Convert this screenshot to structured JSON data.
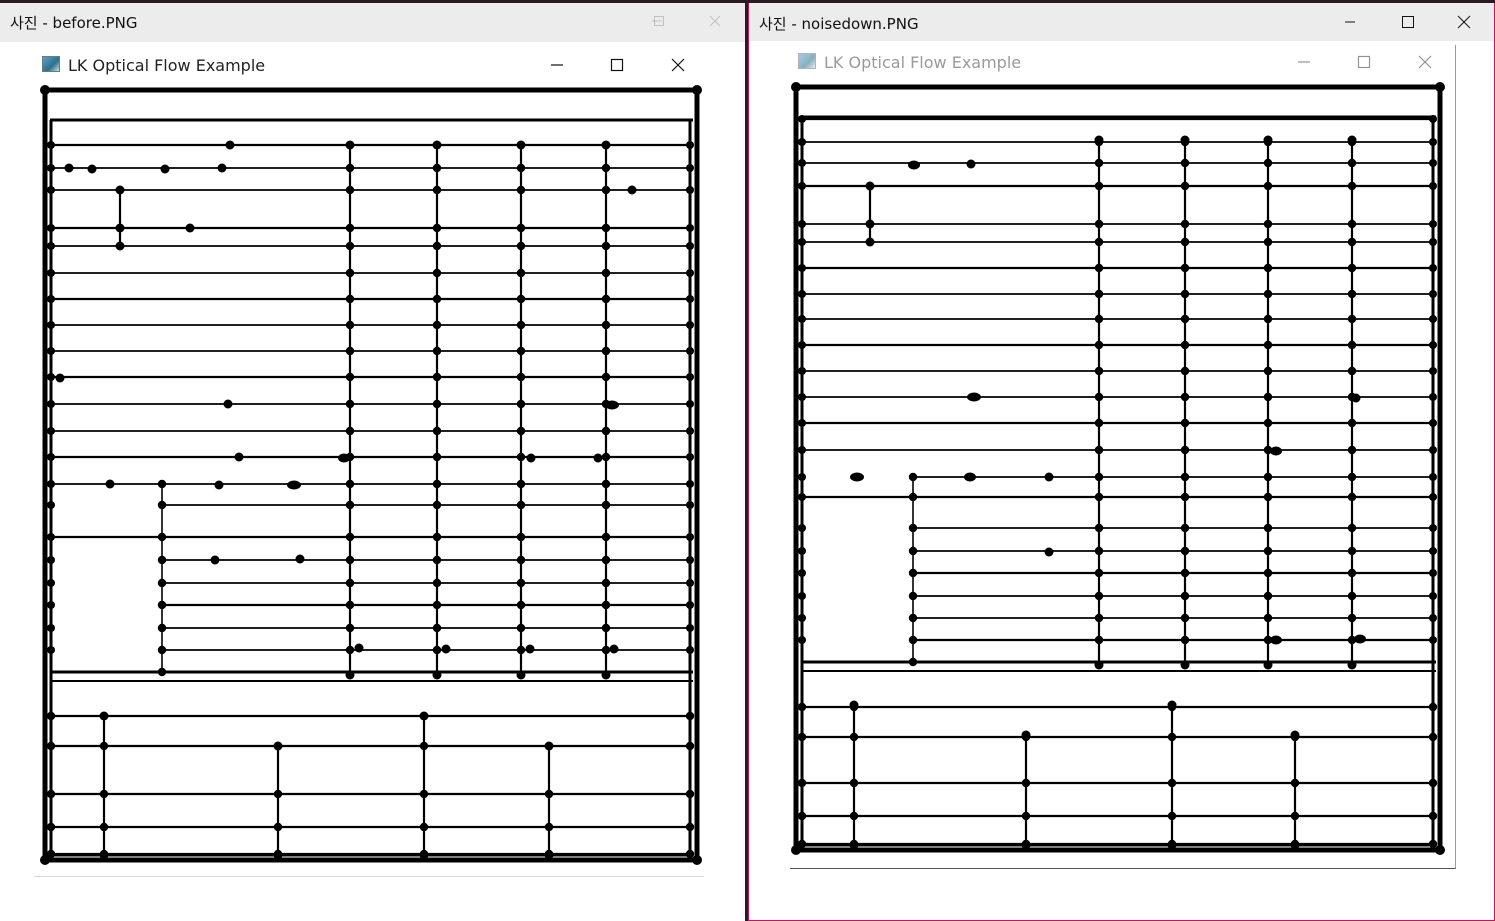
{
  "windows": {
    "left": {
      "title": "사진 - before.PNG",
      "inner_title": "LK Optical Flow Example"
    },
    "right": {
      "title": "사진 - noisedown.PNG",
      "inner_title": "LK Optical Flow Example"
    }
  },
  "icons": {
    "minimize": "minimize-icon",
    "maximize": "maximize-icon",
    "close": "close-icon",
    "app": "app-icon"
  },
  "colors": {
    "titlebar": "#ececec",
    "ink": "#000000",
    "accent_border": "#c2185b"
  }
}
